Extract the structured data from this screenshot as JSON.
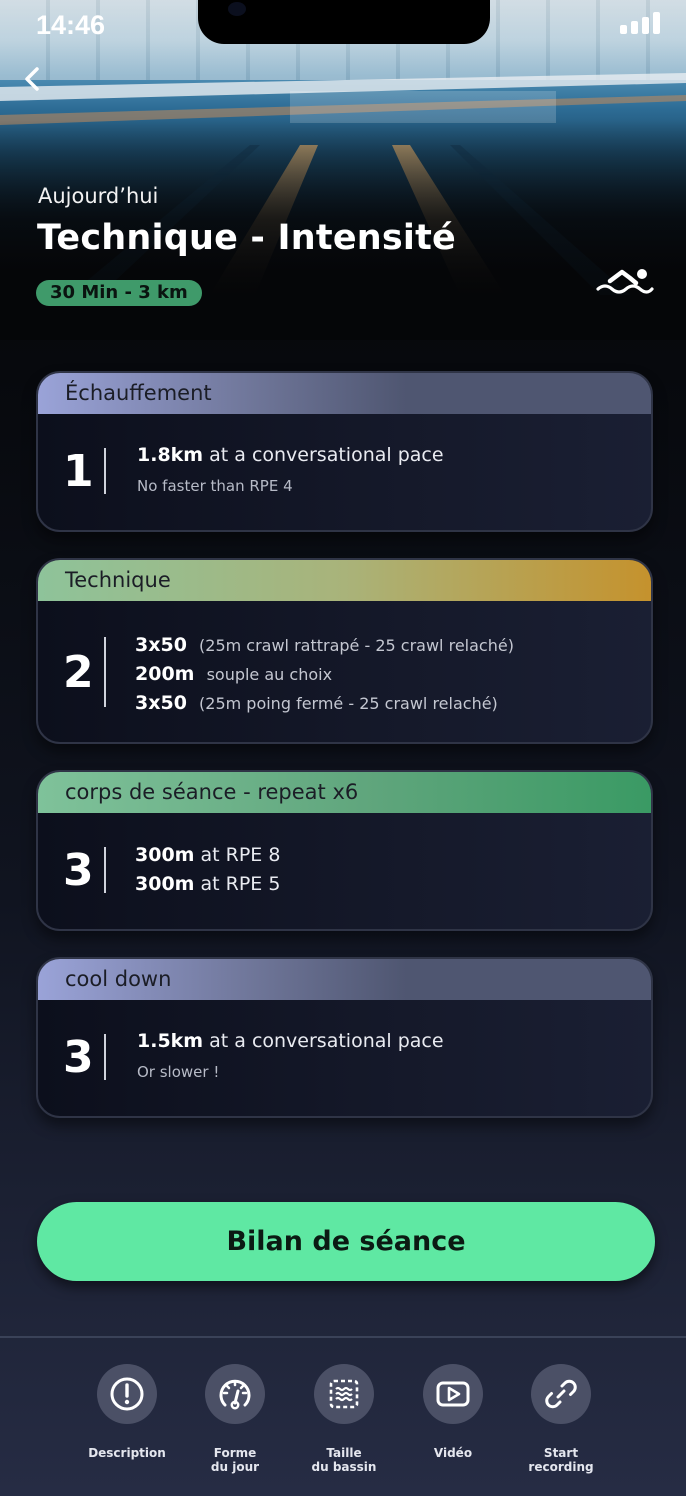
{
  "status_bar": {
    "time": "14:46"
  },
  "header": {
    "date_label": "Aujourd’hui",
    "title": "Technique - Intensité",
    "badge": "30 Min - 3 km"
  },
  "icons": {
    "back": "chevron-left-icon",
    "activity": "swimmer-icon",
    "signal": "signal-bars-icon"
  },
  "sections": [
    {
      "heading": "Échauffement",
      "number": "1",
      "lines": [
        {
          "bold": "1.8km",
          "text": " at a conversational pace"
        }
      ],
      "sub": "No faster than RPE 4"
    },
    {
      "heading": "Technique",
      "number": "2",
      "lines": [
        {
          "bold": "3x50",
          "text": "(25m crawl rattrapé - 25 crawl relaché)"
        },
        {
          "bold": "200m",
          "text": "souple au choix"
        },
        {
          "bold": "3x50",
          "text": "(25m poing fermé - 25 crawl relaché)"
        }
      ]
    },
    {
      "heading": "corps de séance - repeat x6",
      "number": "3",
      "lines": [
        {
          "bold": "300m",
          "text": " at RPE 8"
        },
        {
          "bold": "300m",
          "text": " at RPE 5"
        }
      ]
    },
    {
      "heading": "cool down",
      "number": "3",
      "lines": [
        {
          "bold": "1.5km",
          "text": " at a conversational pace"
        }
      ],
      "sub": "Or slower !"
    }
  ],
  "cta": {
    "label": "Bilan de séance"
  },
  "tab_bar": [
    {
      "label": "Description",
      "icon": "alert-circle-icon"
    },
    {
      "label": "Forme\ndu jour",
      "icon": "gauge-icon"
    },
    {
      "label": "Taille\ndu bassin",
      "icon": "pool-size-icon"
    },
    {
      "label": "Vidéo",
      "icon": "play-video-icon"
    },
    {
      "label": "Start\nrecording",
      "icon": "link-icon"
    }
  ],
  "colors": {
    "accent_green": "#5fe8a3",
    "badge_green": "#3f9a6a",
    "section_warmup": "#9aa3d8",
    "section_technique_start": "#8ec39a",
    "section_technique_end": "#c5922d",
    "section_main_start": "#7fc29a",
    "section_main_end": "#3a9a64",
    "section_cooldown": "#9aa3d8"
  }
}
